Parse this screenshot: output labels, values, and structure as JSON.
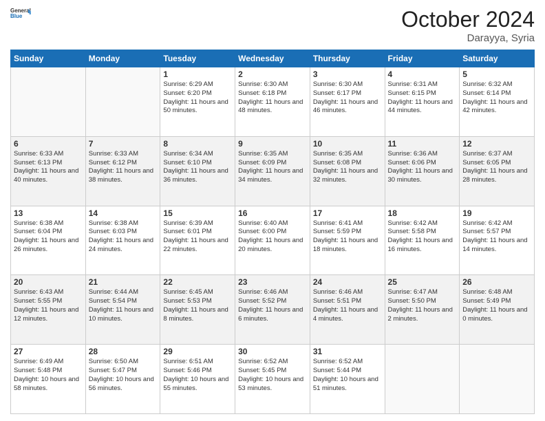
{
  "header": {
    "logo_line1": "General",
    "logo_line2": "Blue",
    "month_title": "October 2024",
    "location": "Darayya, Syria"
  },
  "weekdays": [
    "Sunday",
    "Monday",
    "Tuesday",
    "Wednesday",
    "Thursday",
    "Friday",
    "Saturday"
  ],
  "weeks": [
    [
      {
        "day": "",
        "info": ""
      },
      {
        "day": "",
        "info": ""
      },
      {
        "day": "1",
        "info": "Sunrise: 6:29 AM\nSunset: 6:20 PM\nDaylight: 11 hours and 50 minutes."
      },
      {
        "day": "2",
        "info": "Sunrise: 6:30 AM\nSunset: 6:18 PM\nDaylight: 11 hours and 48 minutes."
      },
      {
        "day": "3",
        "info": "Sunrise: 6:30 AM\nSunset: 6:17 PM\nDaylight: 11 hours and 46 minutes."
      },
      {
        "day": "4",
        "info": "Sunrise: 6:31 AM\nSunset: 6:15 PM\nDaylight: 11 hours and 44 minutes."
      },
      {
        "day": "5",
        "info": "Sunrise: 6:32 AM\nSunset: 6:14 PM\nDaylight: 11 hours and 42 minutes."
      }
    ],
    [
      {
        "day": "6",
        "info": "Sunrise: 6:33 AM\nSunset: 6:13 PM\nDaylight: 11 hours and 40 minutes."
      },
      {
        "day": "7",
        "info": "Sunrise: 6:33 AM\nSunset: 6:12 PM\nDaylight: 11 hours and 38 minutes."
      },
      {
        "day": "8",
        "info": "Sunrise: 6:34 AM\nSunset: 6:10 PM\nDaylight: 11 hours and 36 minutes."
      },
      {
        "day": "9",
        "info": "Sunrise: 6:35 AM\nSunset: 6:09 PM\nDaylight: 11 hours and 34 minutes."
      },
      {
        "day": "10",
        "info": "Sunrise: 6:35 AM\nSunset: 6:08 PM\nDaylight: 11 hours and 32 minutes."
      },
      {
        "day": "11",
        "info": "Sunrise: 6:36 AM\nSunset: 6:06 PM\nDaylight: 11 hours and 30 minutes."
      },
      {
        "day": "12",
        "info": "Sunrise: 6:37 AM\nSunset: 6:05 PM\nDaylight: 11 hours and 28 minutes."
      }
    ],
    [
      {
        "day": "13",
        "info": "Sunrise: 6:38 AM\nSunset: 6:04 PM\nDaylight: 11 hours and 26 minutes."
      },
      {
        "day": "14",
        "info": "Sunrise: 6:38 AM\nSunset: 6:03 PM\nDaylight: 11 hours and 24 minutes."
      },
      {
        "day": "15",
        "info": "Sunrise: 6:39 AM\nSunset: 6:01 PM\nDaylight: 11 hours and 22 minutes."
      },
      {
        "day": "16",
        "info": "Sunrise: 6:40 AM\nSunset: 6:00 PM\nDaylight: 11 hours and 20 minutes."
      },
      {
        "day": "17",
        "info": "Sunrise: 6:41 AM\nSunset: 5:59 PM\nDaylight: 11 hours and 18 minutes."
      },
      {
        "day": "18",
        "info": "Sunrise: 6:42 AM\nSunset: 5:58 PM\nDaylight: 11 hours and 16 minutes."
      },
      {
        "day": "19",
        "info": "Sunrise: 6:42 AM\nSunset: 5:57 PM\nDaylight: 11 hours and 14 minutes."
      }
    ],
    [
      {
        "day": "20",
        "info": "Sunrise: 6:43 AM\nSunset: 5:55 PM\nDaylight: 11 hours and 12 minutes."
      },
      {
        "day": "21",
        "info": "Sunrise: 6:44 AM\nSunset: 5:54 PM\nDaylight: 11 hours and 10 minutes."
      },
      {
        "day": "22",
        "info": "Sunrise: 6:45 AM\nSunset: 5:53 PM\nDaylight: 11 hours and 8 minutes."
      },
      {
        "day": "23",
        "info": "Sunrise: 6:46 AM\nSunset: 5:52 PM\nDaylight: 11 hours and 6 minutes."
      },
      {
        "day": "24",
        "info": "Sunrise: 6:46 AM\nSunset: 5:51 PM\nDaylight: 11 hours and 4 minutes."
      },
      {
        "day": "25",
        "info": "Sunrise: 6:47 AM\nSunset: 5:50 PM\nDaylight: 11 hours and 2 minutes."
      },
      {
        "day": "26",
        "info": "Sunrise: 6:48 AM\nSunset: 5:49 PM\nDaylight: 11 hours and 0 minutes."
      }
    ],
    [
      {
        "day": "27",
        "info": "Sunrise: 6:49 AM\nSunset: 5:48 PM\nDaylight: 10 hours and 58 minutes."
      },
      {
        "day": "28",
        "info": "Sunrise: 6:50 AM\nSunset: 5:47 PM\nDaylight: 10 hours and 56 minutes."
      },
      {
        "day": "29",
        "info": "Sunrise: 6:51 AM\nSunset: 5:46 PM\nDaylight: 10 hours and 55 minutes."
      },
      {
        "day": "30",
        "info": "Sunrise: 6:52 AM\nSunset: 5:45 PM\nDaylight: 10 hours and 53 minutes."
      },
      {
        "day": "31",
        "info": "Sunrise: 6:52 AM\nSunset: 5:44 PM\nDaylight: 10 hours and 51 minutes."
      },
      {
        "day": "",
        "info": ""
      },
      {
        "day": "",
        "info": ""
      }
    ]
  ]
}
